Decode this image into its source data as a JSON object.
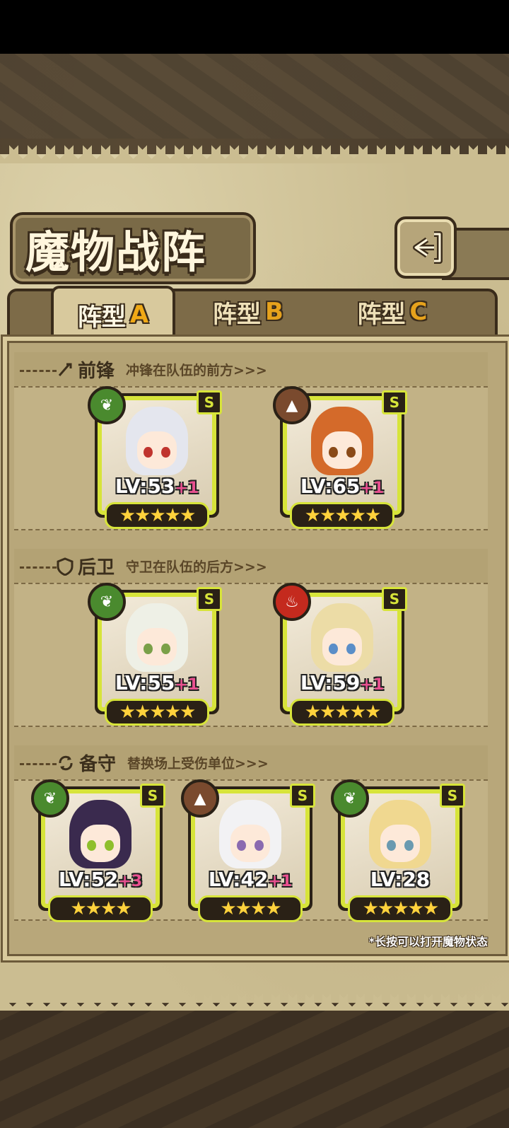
{
  "title": "魔物战阵",
  "back_icon": "back-arrow-icon",
  "tabs": [
    {
      "label": "阵型",
      "letter": "A",
      "active": true
    },
    {
      "label": "阵型",
      "letter": "B",
      "active": false
    },
    {
      "label": "阵型",
      "letter": "C",
      "active": false
    }
  ],
  "sections": [
    {
      "name": "前锋",
      "icon": "sword-icon",
      "desc": "冲锋在队伍的前方>>>"
    },
    {
      "name": "后卫",
      "icon": "shield-icon",
      "desc": "守卫在队伍的后方>>>"
    },
    {
      "name": "备守",
      "icon": "swap-icon",
      "desc": "替换场上受伤单位>>>"
    }
  ],
  "units": {
    "front": [
      {
        "lv": "LV:53",
        "plus": "+1",
        "grade": "S",
        "element": "leaf",
        "stars": "★★★★★",
        "hair": "#e4e6ee",
        "eye": "#c0342e"
      },
      {
        "lv": "LV:65",
        "plus": "+1",
        "grade": "S",
        "element": "earth",
        "stars": "★★★★★",
        "hair": "#d46a2a",
        "eye": "#8a4a18"
      }
    ],
    "back": [
      {
        "lv": "LV:55",
        "plus": "+1",
        "grade": "S",
        "element": "leaf",
        "stars": "★★★★★",
        "hair": "#eef0e6",
        "eye": "#7aa048"
      },
      {
        "lv": "LV:59",
        "plus": "+1",
        "grade": "S",
        "element": "fire",
        "stars": "★★★★★",
        "hair": "#ecdca6",
        "eye": "#5a8ec8"
      }
    ],
    "reserve": [
      {
        "lv": "LV:52",
        "plus": "+3",
        "grade": "S",
        "element": "leaf",
        "stars": "★★★★",
        "hair": "#3a2a4e",
        "eye": "#8fbf2c"
      },
      {
        "lv": "LV:42",
        "plus": "+1",
        "grade": "S",
        "element": "earth",
        "stars": "★★★★",
        "hair": "#f2f2f4",
        "eye": "#8a6ab0"
      },
      {
        "lv": "LV:28",
        "plus": "",
        "grade": "S",
        "element": "leaf",
        "stars": "★★★★★",
        "hair": "#f0d890",
        "eye": "#6a9ab0"
      }
    ]
  },
  "element_colors": {
    "leaf": "#4a8a2e",
    "earth": "#7a4a2e",
    "fire": "#c42a1e"
  },
  "hint": "*长按可以打开魔物状态"
}
